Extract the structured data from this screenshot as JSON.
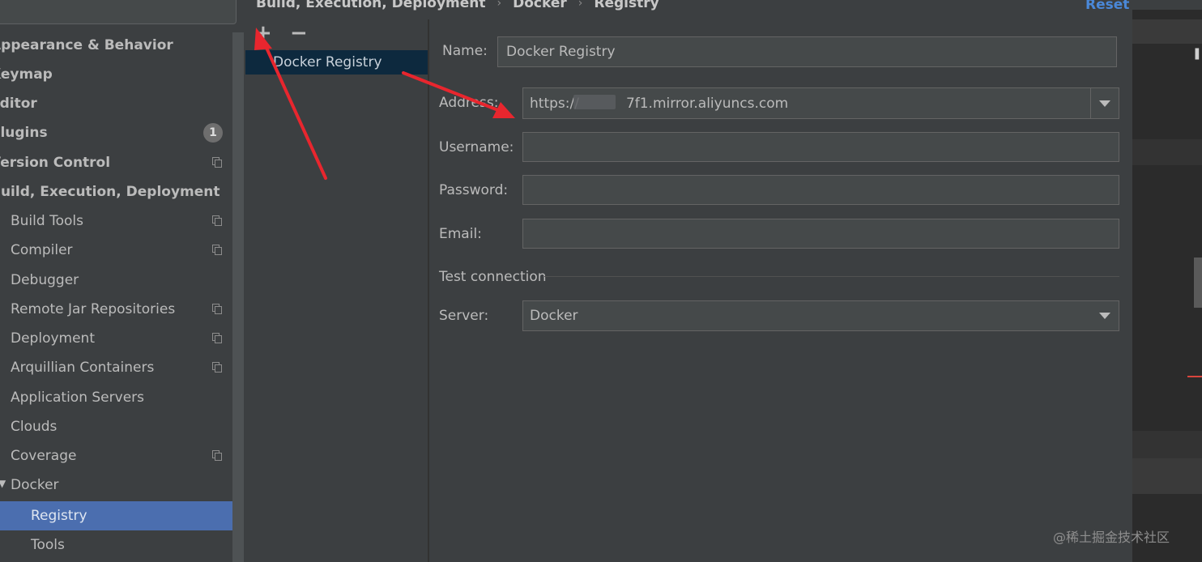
{
  "search": {
    "value": ""
  },
  "sidebar": {
    "items": [
      {
        "label": "Appearance & Behavior"
      },
      {
        "label": "Keymap"
      },
      {
        "label": "Editor"
      },
      {
        "label": "Plugins",
        "badge": "1"
      },
      {
        "label": "Version Control"
      },
      {
        "label": "Build, Execution, Deployment"
      },
      {
        "label": "Build Tools"
      },
      {
        "label": "Compiler"
      },
      {
        "label": "Debugger"
      },
      {
        "label": "Remote Jar Repositories"
      },
      {
        "label": "Deployment"
      },
      {
        "label": "Arquillian Containers"
      },
      {
        "label": "Application Servers"
      },
      {
        "label": "Clouds"
      },
      {
        "label": "Coverage"
      },
      {
        "label": "Docker"
      },
      {
        "label": "Registry"
      },
      {
        "label": "Tools"
      }
    ]
  },
  "breadcrumb": [
    "Build, Execution, Deployment",
    "Docker",
    "Registry"
  ],
  "breadcrumb_separator": "›",
  "reset_label": "Reset",
  "list_toolbar": {
    "add": "+",
    "remove": "−"
  },
  "registry_list": {
    "items": [
      "Docker Registry"
    ]
  },
  "form": {
    "name_label": "Name:",
    "name_value": "Docker Registry",
    "address_label": "Address:",
    "address_prefix": "https://",
    "address_suffix": "7f1.mirror.aliyuncs.com",
    "username_label": "Username:",
    "username_value": "",
    "password_label": "Password:",
    "password_value": "",
    "email_label": "Email:",
    "email_value": "",
    "test_connection_label": "Test connection",
    "server_label": "Server:",
    "server_value": "Docker"
  },
  "watermark": "@稀土掘金技术社区",
  "colors": {
    "background": "#3c3f41",
    "selection": "#4b6eaf",
    "list_selection": "#0d293e",
    "link": "#4a88d8",
    "annotation_arrow": "#e8262e"
  }
}
